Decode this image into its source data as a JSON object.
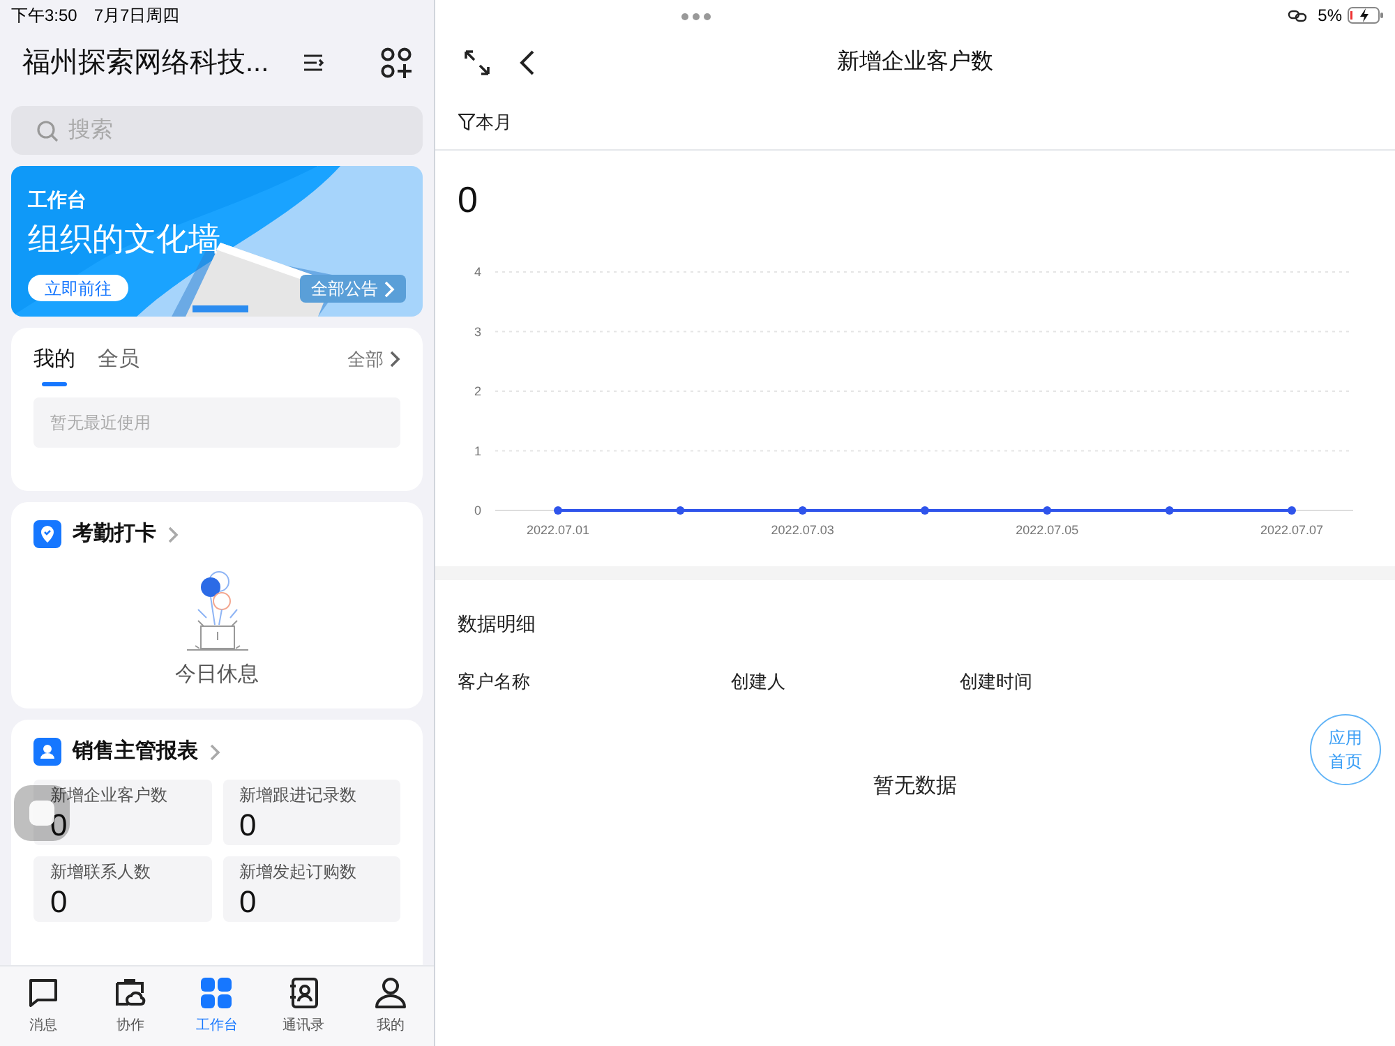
{
  "status_bar": {
    "time": "下午3:50",
    "date": "7月7日周四",
    "battery": "5%"
  },
  "header": {
    "title": "福州探索网络科技..."
  },
  "search": {
    "placeholder": "搜索"
  },
  "banner": {
    "kind": "picture",
    "subtitle": "工作台",
    "title": "组织的文化墙",
    "button": "立即前往",
    "link": "全部公告"
  },
  "recent": {
    "tabs": [
      {
        "label": "我的",
        "selected": true
      },
      {
        "label": "全员",
        "selected": false
      }
    ],
    "all_link": "全部",
    "empty": "暂无最近使用"
  },
  "attendance": {
    "title": "考勤打卡",
    "message": "今日休息"
  },
  "sales_report": {
    "title": "销售主管报表",
    "stats": [
      {
        "label": "新增企业客户数",
        "value": "0"
      },
      {
        "label": "新增跟进记录数",
        "value": "0"
      },
      {
        "label": "新增联系人数",
        "value": "0"
      },
      {
        "label": "新增发起订购数",
        "value": "0"
      }
    ]
  },
  "tab_bar": [
    {
      "label": "消息",
      "kind": "chat",
      "selected": false
    },
    {
      "label": "协作",
      "kind": "collab",
      "selected": false
    },
    {
      "label": "工作台",
      "kind": "grid",
      "selected": true
    },
    {
      "label": "通讯录",
      "kind": "contacts",
      "selected": false
    },
    {
      "label": "我的",
      "kind": "person",
      "selected": false
    }
  ],
  "detail": {
    "title": "新增企业客户数",
    "filter": "本月",
    "total": "0",
    "chart_data": {
      "type": "line",
      "categories": [
        "2022.07.01",
        null,
        "2022.07.03",
        null,
        "2022.07.05",
        null,
        "2022.07.07"
      ],
      "series": [
        {
          "color": "#2f54eb",
          "marker": "circle",
          "values": [
            0,
            0,
            0,
            0,
            0,
            0,
            0
          ]
        }
      ],
      "ylim": [
        0,
        4
      ],
      "yticks": [
        0,
        1,
        2,
        3,
        4
      ],
      "grid": true
    },
    "section_title": "数据明细",
    "columns": [
      "客户名称",
      "创建人",
      "创建时间"
    ],
    "empty": "暂无数据",
    "fab": [
      "应用",
      "首页"
    ]
  }
}
